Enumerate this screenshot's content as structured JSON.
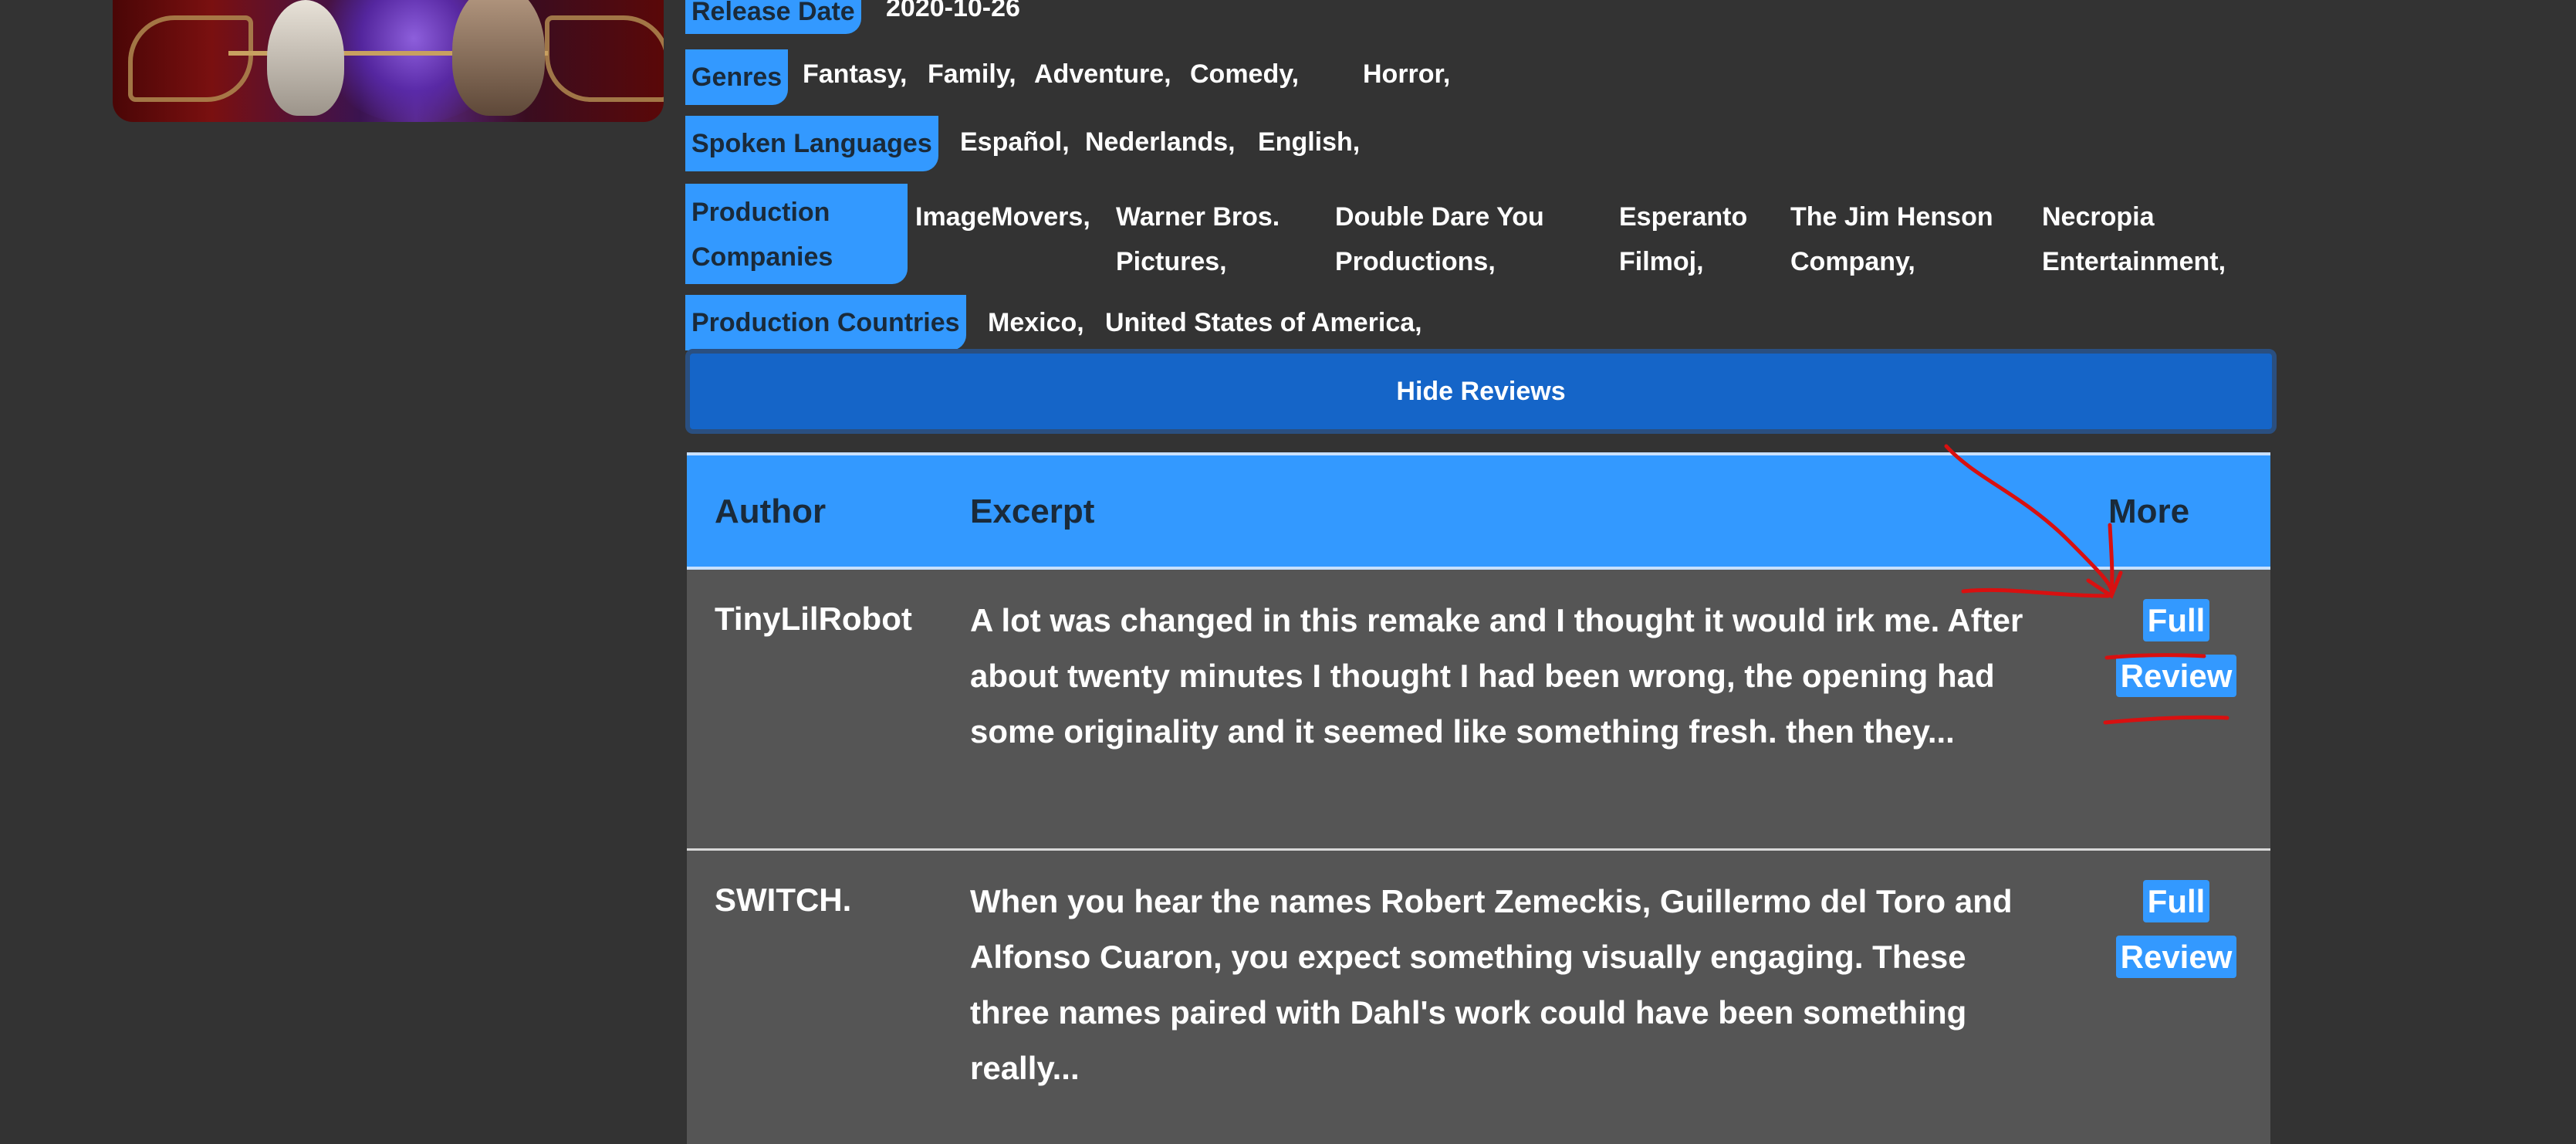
{
  "movie_info": {
    "release_date": {
      "label": "Release Date",
      "value": "2020-10-26"
    },
    "genres": {
      "label": "Genres",
      "values": [
        "Fantasy,",
        "Family,",
        "Adventure,",
        "Comedy,",
        "Horror,"
      ]
    },
    "spoken_languages": {
      "label": "Spoken Languages",
      "values": [
        "Español,",
        "Nederlands,",
        "English,"
      ]
    },
    "production_companies": {
      "label_line1": "Production",
      "label_line2": "Companies",
      "values": [
        {
          "line1": "ImageMovers,",
          "line2": ""
        },
        {
          "line1": "Warner Bros.",
          "line2": "Pictures,"
        },
        {
          "line1": "Double Dare You",
          "line2": "Productions,"
        },
        {
          "line1": "Esperanto",
          "line2": "Filmoj,"
        },
        {
          "line1": "The Jim Henson",
          "line2": "Company,"
        },
        {
          "line1": "Necropia",
          "line2": "Entertainment,"
        }
      ]
    },
    "production_countries": {
      "label": "Production Countries",
      "values": [
        "Mexico,",
        "United States of America,"
      ]
    }
  },
  "hide_reviews_label": "Hide Reviews",
  "reviews_table": {
    "headers": {
      "author": "Author",
      "excerpt": "Excerpt",
      "more": "More"
    },
    "rows": [
      {
        "author": "TinyLilRobot",
        "excerpt": "A lot was changed in this remake and I thought it would irk me. After about twenty minutes I thought I had been wrong, the opening had some originality and it seemed like something fresh. then they...",
        "more_label": "Full Review"
      },
      {
        "author": "SWITCH.",
        "excerpt": "When you hear the names Robert Zemeckis, Guillermo del Toro and Alfonso Cuaron, you expect something visually engaging. These three names paired with Dahl's work could have been something really...",
        "more_label": "Full Review"
      }
    ]
  },
  "colors": {
    "accent": "#3399ff",
    "button": "#1565c8",
    "background": "#333333",
    "row": "#555555",
    "annotation": "#d81010"
  }
}
